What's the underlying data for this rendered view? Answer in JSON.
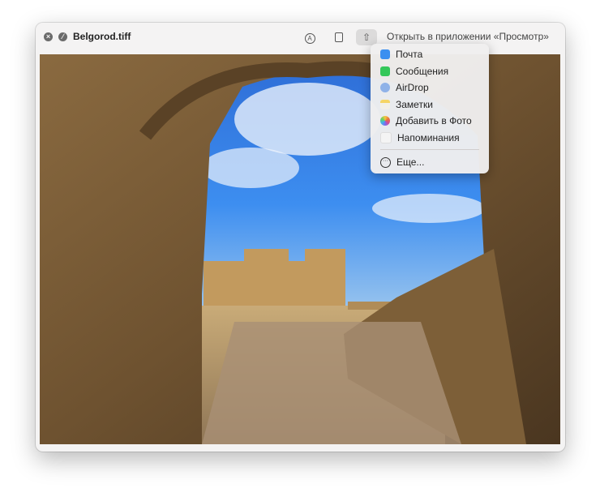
{
  "window": {
    "title": "Belgorod.tiff",
    "open_in": "Открыть в приложении «Просмотр»"
  },
  "share_menu": {
    "items": [
      {
        "label": "Почта",
        "icon": "mail-icon",
        "color": "#3b8ff0"
      },
      {
        "label": "Сообщения",
        "icon": "messages-icon",
        "color": "#34c759"
      },
      {
        "label": "AirDrop",
        "icon": "airdrop-icon",
        "color": "#8fb2e8"
      },
      {
        "label": "Заметки",
        "icon": "notes-icon",
        "color": "#f5d565"
      },
      {
        "label": "Добавить в Фото",
        "icon": "photos-icon",
        "color": "#e8743c"
      },
      {
        "label": "Напоминания",
        "icon": "reminders-icon",
        "color": "#e6e6e6"
      }
    ],
    "more": "Еще..."
  }
}
